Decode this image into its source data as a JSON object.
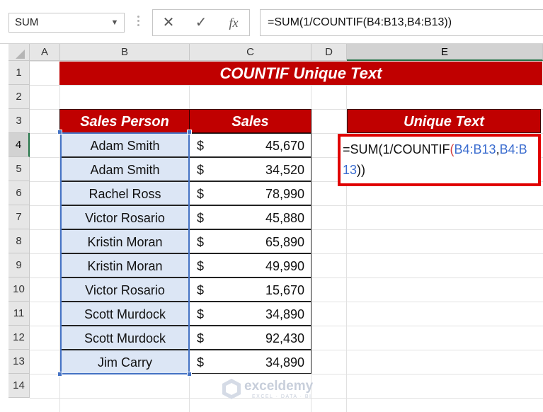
{
  "formula_bar": {
    "name_box": "SUM",
    "cancel_icon": "close-icon",
    "enter_icon": "check-icon",
    "fx_label": "fx",
    "formula": "=SUM(1/COUNTIF(B4:B13,B4:B13))"
  },
  "columns": [
    "A",
    "B",
    "C",
    "D",
    "E"
  ],
  "rows": [
    "1",
    "2",
    "3",
    "4",
    "5",
    "6",
    "7",
    "8",
    "9",
    "10",
    "11",
    "12",
    "13",
    "14"
  ],
  "active_cell": {
    "column": "E",
    "row": "4"
  },
  "sheet": {
    "title": "COUNTIF Unique Text",
    "header_sales_person": "Sales Person",
    "header_sales": "Sales",
    "header_unique": "Unique Text",
    "records": [
      {
        "name": "Adam Smith",
        "currency": "$",
        "amount": "45,670"
      },
      {
        "name": "Adam Smith",
        "currency": "$",
        "amount": "34,520"
      },
      {
        "name": "Rachel Ross",
        "currency": "$",
        "amount": "78,990"
      },
      {
        "name": "Victor Rosario",
        "currency": "$",
        "amount": "45,880"
      },
      {
        "name": "Kristin Moran",
        "currency": "$",
        "amount": "65,890"
      },
      {
        "name": "Kristin Moran",
        "currency": "$",
        "amount": "49,990"
      },
      {
        "name": "Victor Rosario",
        "currency": "$",
        "amount": "15,670"
      },
      {
        "name": "Scott Murdock",
        "currency": "$",
        "amount": "34,890"
      },
      {
        "name": "Scott Murdock",
        "currency": "$",
        "amount": "92,430"
      },
      {
        "name": "Jim Carry",
        "currency": "$",
        "amount": "34,890"
      }
    ],
    "edit_formula": {
      "prefix": "=SUM(1/COUNTIF",
      "open_paren": "(",
      "ref1": "B4:B13",
      "comma": ",",
      "ref2": "B4:B13",
      "close_parens": "))"
    }
  },
  "watermark": {
    "name": "exceldemy",
    "tagline": "EXCEL · DATA · BI"
  },
  "colors": {
    "header_red": "#c00000",
    "selection_blue": "#4472c4",
    "edit_border": "#e00000",
    "name_fill": "#dce6f5"
  }
}
